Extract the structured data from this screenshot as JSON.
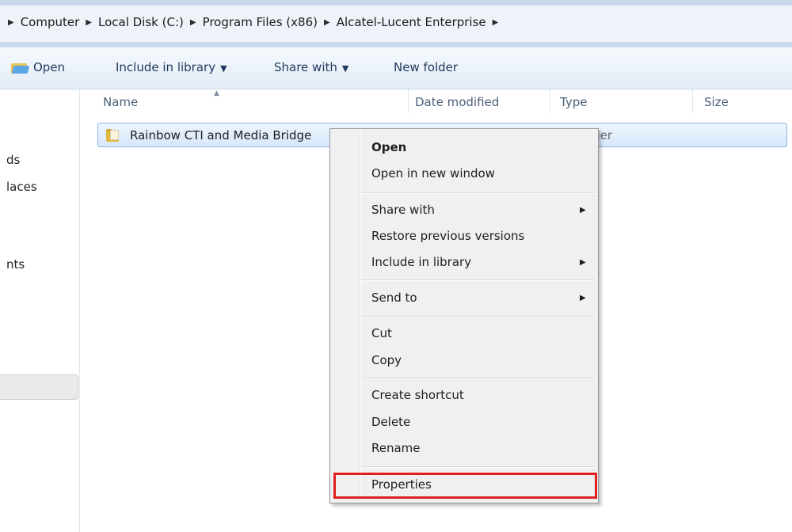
{
  "address": {
    "crumbs": [
      "Computer",
      "Local Disk (C:)",
      "Program Files (x86)",
      "Alcatel-Lucent Enterprise"
    ]
  },
  "toolbar": {
    "open_label": "Open",
    "include_label": "Include in library",
    "share_label": "Share with",
    "new_folder_label": "New folder"
  },
  "nav": {
    "items": [
      "ds",
      "laces",
      "nts"
    ]
  },
  "columns": {
    "name": "Name",
    "date_modified": "Date modified",
    "type": "Type",
    "size": "Size"
  },
  "file": {
    "name": "Rainbow CTI and Media Bridge",
    "type_visible": "lder"
  },
  "context_menu": {
    "open": "Open",
    "open_new_window": "Open in new window",
    "share_with": "Share with",
    "restore_previous": "Restore previous versions",
    "include_in_library": "Include in library",
    "send_to": "Send to",
    "cut": "Cut",
    "copy": "Copy",
    "create_shortcut": "Create shortcut",
    "delete": "Delete",
    "rename": "Rename",
    "properties": "Properties"
  },
  "colors": {
    "highlight_border": "#e02020",
    "selection_fill": "#d6e7fb"
  }
}
